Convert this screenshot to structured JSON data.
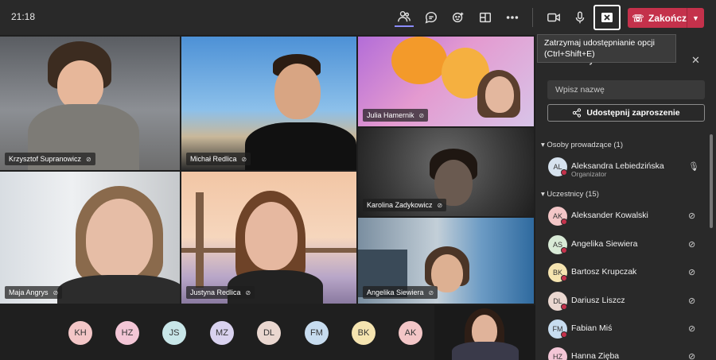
{
  "topbar": {
    "time": "21:18",
    "leave_label": "Zakończ"
  },
  "tooltip": "Zatrzymaj udostępnianie opcji (Ctrl+Shift+E)",
  "tiles": [
    {
      "name": "Krzysztof Supranowicz"
    },
    {
      "name": "Michał Redlica"
    },
    {
      "name": "Julia Hamernik"
    },
    {
      "name": "Karolina Zadykowicz"
    },
    {
      "name": "Maja Angrys"
    },
    {
      "name": "Justyna Redlica"
    },
    {
      "name": "Angelika Siewiera"
    }
  ],
  "avatars": [
    {
      "initials": "KH",
      "color": "#f3c6c7"
    },
    {
      "initials": "HZ",
      "color": "#f3c6d6"
    },
    {
      "initials": "JS",
      "color": "#c8e6e8"
    },
    {
      "initials": "MZ",
      "color": "#d9d2ef"
    },
    {
      "initials": "DL",
      "color": "#ead7d0"
    },
    {
      "initials": "FM",
      "color": "#c7dcef"
    },
    {
      "initials": "BK",
      "color": "#f5e4b0"
    },
    {
      "initials": "AK",
      "color": "#f3c6c7"
    }
  ],
  "panel": {
    "title": "Uczestnicy",
    "search_placeholder": "Wpisz nazwę",
    "invite_label": "Udostępnij zaproszenie",
    "presenters_header": "Osoby prowadzące (1)",
    "attendees_header": "Uczestnicy (15)",
    "presenters": [
      {
        "initials": "AL",
        "name": "Aleksandra Lebiedzińska",
        "role": "Organizator",
        "color": "#d6e2ee"
      }
    ],
    "attendees": [
      {
        "initials": "AK",
        "name": "Aleksander Kowalski",
        "color": "#f3c6c7"
      },
      {
        "initials": "AS",
        "name": "Angelika Siewiera",
        "color": "#d8ead6"
      },
      {
        "initials": "BK",
        "name": "Bartosz Krupczak",
        "color": "#f5e4b0"
      },
      {
        "initials": "DL",
        "name": "Dariusz Liszcz",
        "color": "#ead7d0"
      },
      {
        "initials": "FM",
        "name": "Fabian Miś",
        "color": "#c7dcef"
      },
      {
        "initials": "HZ",
        "name": "Hanna Zięba",
        "color": "#f3c6d6"
      }
    ]
  }
}
